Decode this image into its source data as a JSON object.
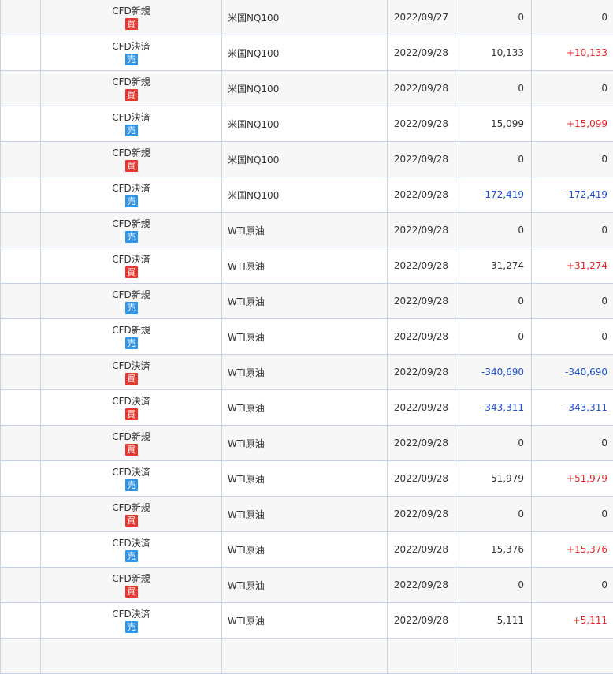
{
  "colors": {
    "buy_badge": "#e8372f",
    "sell_badge": "#2e95e8",
    "negative": "#1a4fd6",
    "positive": "#e82626",
    "border": "#c9d3e6"
  },
  "rows": [
    {
      "kind": "CFD新規",
      "side": "買",
      "side_type": "buy",
      "name": "米国NQ100",
      "date": "2022/09/27",
      "amount": "0",
      "profit": "0",
      "sign": "zero"
    },
    {
      "kind": "CFD決済",
      "side": "売",
      "side_type": "sell",
      "name": "米国NQ100",
      "date": "2022/09/28",
      "amount": "10,133",
      "profit": "+10,133",
      "sign": "pos"
    },
    {
      "kind": "CFD新規",
      "side": "買",
      "side_type": "buy",
      "name": "米国NQ100",
      "date": "2022/09/28",
      "amount": "0",
      "profit": "0",
      "sign": "zero"
    },
    {
      "kind": "CFD決済",
      "side": "売",
      "side_type": "sell",
      "name": "米国NQ100",
      "date": "2022/09/28",
      "amount": "15,099",
      "profit": "+15,099",
      "sign": "pos"
    },
    {
      "kind": "CFD新規",
      "side": "買",
      "side_type": "buy",
      "name": "米国NQ100",
      "date": "2022/09/28",
      "amount": "0",
      "profit": "0",
      "sign": "zero"
    },
    {
      "kind": "CFD決済",
      "side": "売",
      "side_type": "sell",
      "name": "米国NQ100",
      "date": "2022/09/28",
      "amount": "-172,419",
      "profit": "-172,419",
      "sign": "neg"
    },
    {
      "kind": "CFD新規",
      "side": "売",
      "side_type": "sell",
      "name": "WTI原油",
      "date": "2022/09/28",
      "amount": "0",
      "profit": "0",
      "sign": "zero"
    },
    {
      "kind": "CFD決済",
      "side": "買",
      "side_type": "buy",
      "name": "WTI原油",
      "date": "2022/09/28",
      "amount": "31,274",
      "profit": "+31,274",
      "sign": "pos"
    },
    {
      "kind": "CFD新規",
      "side": "売",
      "side_type": "sell",
      "name": "WTI原油",
      "date": "2022/09/28",
      "amount": "0",
      "profit": "0",
      "sign": "zero"
    },
    {
      "kind": "CFD新規",
      "side": "売",
      "side_type": "sell",
      "name": "WTI原油",
      "date": "2022/09/28",
      "amount": "0",
      "profit": "0",
      "sign": "zero"
    },
    {
      "kind": "CFD決済",
      "side": "買",
      "side_type": "buy",
      "name": "WTI原油",
      "date": "2022/09/28",
      "amount": "-340,690",
      "profit": "-340,690",
      "sign": "neg"
    },
    {
      "kind": "CFD決済",
      "side": "買",
      "side_type": "buy",
      "name": "WTI原油",
      "date": "2022/09/28",
      "amount": "-343,311",
      "profit": "-343,311",
      "sign": "neg"
    },
    {
      "kind": "CFD新規",
      "side": "買",
      "side_type": "buy",
      "name": "WTI原油",
      "date": "2022/09/28",
      "amount": "0",
      "profit": "0",
      "sign": "zero"
    },
    {
      "kind": "CFD決済",
      "side": "売",
      "side_type": "sell",
      "name": "WTI原油",
      "date": "2022/09/28",
      "amount": "51,979",
      "profit": "+51,979",
      "sign": "pos"
    },
    {
      "kind": "CFD新規",
      "side": "買",
      "side_type": "buy",
      "name": "WTI原油",
      "date": "2022/09/28",
      "amount": "0",
      "profit": "0",
      "sign": "zero"
    },
    {
      "kind": "CFD決済",
      "side": "売",
      "side_type": "sell",
      "name": "WTI原油",
      "date": "2022/09/28",
      "amount": "15,376",
      "profit": "+15,376",
      "sign": "pos"
    },
    {
      "kind": "CFD新規",
      "side": "買",
      "side_type": "buy",
      "name": "WTI原油",
      "date": "2022/09/28",
      "amount": "0",
      "profit": "0",
      "sign": "zero"
    },
    {
      "kind": "CFD決済",
      "side": "売",
      "side_type": "sell",
      "name": "WTI原油",
      "date": "2022/09/28",
      "amount": "5,111",
      "profit": "+5,111",
      "sign": "pos"
    },
    {
      "kind": "",
      "side": "",
      "side_type": "",
      "name": "",
      "date": "",
      "amount": "",
      "profit": "",
      "sign": "zero"
    }
  ]
}
